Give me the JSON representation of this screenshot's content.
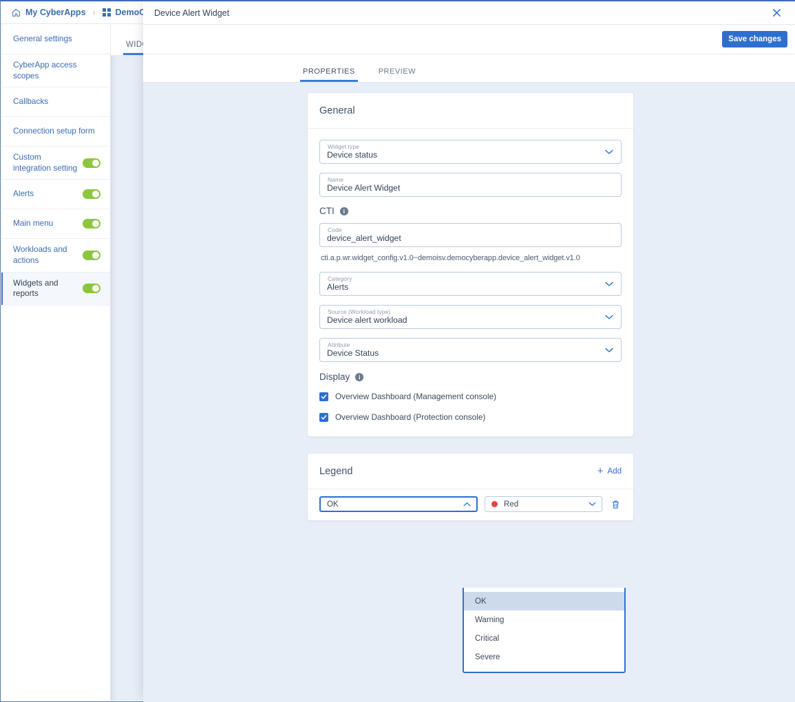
{
  "breadcrumb": {
    "items": [
      {
        "label": "My CyberApps",
        "icon": "home-icon"
      },
      {
        "label": "DemoCyber",
        "icon": "grid-icon"
      }
    ],
    "separator": "›"
  },
  "sidebar": {
    "items": [
      {
        "label": "General settings",
        "toggle": false,
        "selected": false
      },
      {
        "label": "CyberApp access scopes",
        "toggle": false,
        "selected": false
      },
      {
        "label": "Callbacks",
        "toggle": false,
        "selected": false
      },
      {
        "label": "Connection setup form",
        "toggle": false,
        "selected": false
      },
      {
        "label": "Custom integration setting",
        "toggle": true,
        "selected": false
      },
      {
        "label": "Alerts",
        "toggle": true,
        "selected": false
      },
      {
        "label": "Main menu",
        "toggle": true,
        "selected": false
      },
      {
        "label": "Workloads and actions",
        "toggle": true,
        "selected": false
      },
      {
        "label": "Widgets and reports",
        "toggle": true,
        "selected": true
      }
    ],
    "toggle_color": "#8cc63e",
    "link_color": "#3a6cb5"
  },
  "background_page": {
    "tabs": [
      {
        "label": "WIDGET",
        "active": true
      }
    ]
  },
  "modal": {
    "title": "Device Alert Widget",
    "close_icon": "close-icon",
    "save_label": "Save changes",
    "save_color": "#2d6fd1",
    "tabs": [
      {
        "label": "PROPERTIES",
        "active": true
      },
      {
        "label": "PREVIEW",
        "active": false
      }
    ]
  },
  "general": {
    "title": "General",
    "widget_type": {
      "label": "Widget type",
      "value": "Device status"
    },
    "name": {
      "label": "Name",
      "value": "Device Alert Widget"
    },
    "cti": {
      "heading": "CTI",
      "info_icon": "info-icon",
      "info_glyph": "i"
    },
    "code": {
      "label": "Code",
      "value": "device_alert_widget"
    },
    "cti_string": "cti.a.p.wr.widget_config.v1.0~demoisv.democyberapp.device_alert_widget.v1.0",
    "category": {
      "label": "Category",
      "value": "Alerts"
    },
    "source": {
      "label": "Source (Workload type)",
      "value": "Device alert workload"
    },
    "attribute": {
      "label": "Attribute",
      "value": "Device Status"
    },
    "display": {
      "heading": "Display",
      "info_icon": "info-icon",
      "info_glyph": "i",
      "checkboxes": [
        {
          "label": "Overview Dashboard (Management console)",
          "checked": true
        },
        {
          "label": "Overview Dashboard (Protection console)",
          "checked": true
        }
      ]
    }
  },
  "legend": {
    "title": "Legend",
    "add_label": "Add",
    "add_icon": "plus-icon",
    "rows": [
      {
        "value": "OK",
        "color_label": "Red",
        "color_hex": "#e8443a",
        "delete_icon": "trash-icon",
        "dropdown_open": true
      }
    ],
    "dropdown_options": [
      {
        "label": "OK",
        "highlighted": true
      },
      {
        "label": "Warning",
        "highlighted": false
      },
      {
        "label": "Critical",
        "highlighted": false
      },
      {
        "label": "Severe",
        "highlighted": false
      }
    ],
    "highlight_color": "#ccdaec"
  }
}
